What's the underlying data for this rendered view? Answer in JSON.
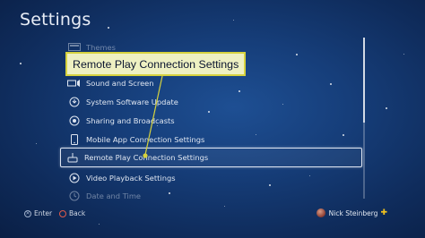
{
  "header": {
    "title": "Settings"
  },
  "menu": {
    "items": [
      {
        "label": "Themes",
        "icon": "themes-icon"
      },
      {
        "label": "",
        "icon": ""
      },
      {
        "label": "Sound and Screen",
        "icon": "sound-screen-icon"
      },
      {
        "label": "System Software Update",
        "icon": "system-update-icon"
      },
      {
        "label": "Sharing and Broadcasts",
        "icon": "sharing-icon"
      },
      {
        "label": "Mobile App Connection Settings",
        "icon": "mobile-app-icon"
      },
      {
        "label": "Remote Play Connection Settings",
        "icon": "remote-play-icon",
        "selected": true
      },
      {
        "label": "Video Playback Settings",
        "icon": "video-playback-icon"
      },
      {
        "label": "Date and Time",
        "icon": "date-time-icon"
      }
    ]
  },
  "callout": {
    "text": "Remote Play Connection Settings",
    "border_color": "#d6d23e",
    "fill_color": "#eef0c2"
  },
  "footer": {
    "enter_label": "Enter",
    "back_label": "Back",
    "username": "Nick Steinberg",
    "plus_color": "#f0c21f"
  }
}
